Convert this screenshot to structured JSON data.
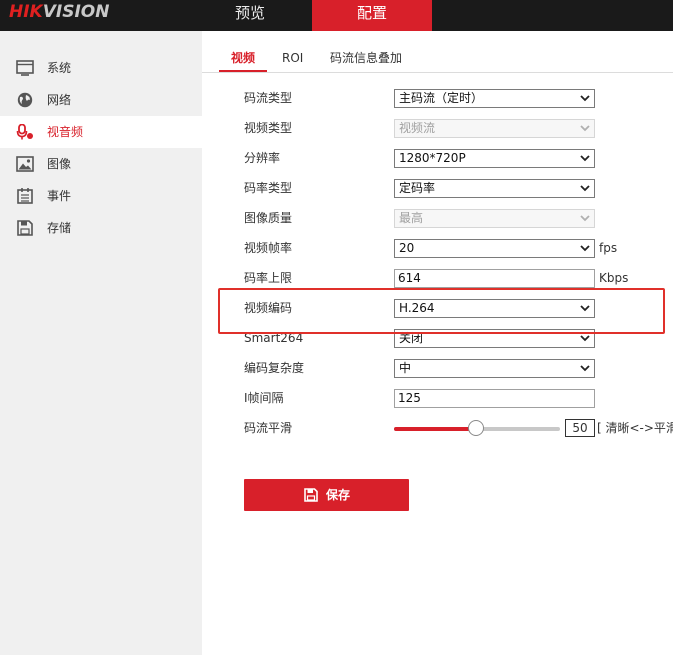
{
  "header": {
    "logo_text_hik": "HIK",
    "logo_text_rest": "VISION",
    "nav_tabs": [
      {
        "label": "预览"
      },
      {
        "label": "配置"
      }
    ]
  },
  "sidebar": {
    "items": [
      {
        "label": "系统",
        "icon": "monitor-icon"
      },
      {
        "label": "网络",
        "icon": "globe-icon"
      },
      {
        "label": "视音频",
        "icon": "microphone-icon",
        "active": true
      },
      {
        "label": "图像",
        "icon": "image-icon"
      },
      {
        "label": "事件",
        "icon": "calendar-icon"
      },
      {
        "label": "存储",
        "icon": "floppy-icon"
      }
    ]
  },
  "subtabs": [
    {
      "label": "视频",
      "active": true
    },
    {
      "label": "ROI"
    },
    {
      "label": "码流信息叠加"
    }
  ],
  "form": {
    "stream_type": {
      "label": "码流类型",
      "value": "主码流（定时）"
    },
    "video_type": {
      "label": "视频类型",
      "value": "视频流",
      "disabled": true
    },
    "resolution": {
      "label": "分辨率",
      "value": "1280*720P"
    },
    "bitrate_type": {
      "label": "码率类型",
      "value": "定码率"
    },
    "image_quality": {
      "label": "图像质量",
      "value": "最高",
      "disabled": true
    },
    "frame_rate": {
      "label": "视频帧率",
      "value": "20",
      "unit": "fps"
    },
    "bitrate_limit": {
      "label": "码率上限",
      "value": "614",
      "unit": "Kbps"
    },
    "video_encoding": {
      "label": "视频编码",
      "value": "H.264"
    },
    "smart264": {
      "label": "Smart264",
      "value": "关闭"
    },
    "encoding_complexity": {
      "label": "编码复杂度",
      "value": "中"
    },
    "i_frame_interval": {
      "label": "I帧间隔",
      "value": "125"
    },
    "stream_smoothing": {
      "label": "码流平滑",
      "value": "50",
      "level_percent": 50,
      "hint": "[ 清晰<->平滑 ]"
    }
  },
  "save_button": {
    "label": "保存"
  },
  "colors": {
    "accent": "#d8202a",
    "highlight": "#e0302a",
    "topbar": "#1a1a1a",
    "sidebar": "#f0f0f0"
  }
}
